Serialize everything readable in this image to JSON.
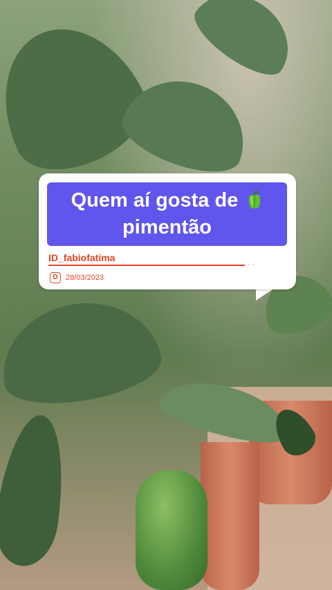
{
  "caption": {
    "line1": "Quem aí gosta de",
    "line2": "pimentão",
    "emoji": "green-bell-pepper"
  },
  "id_label": "ID_fabiofatima",
  "date": "28/03/2023",
  "date_icon_letter": "D",
  "colors": {
    "caption_bg": "#6055ec",
    "caption_text": "#ffffff",
    "accent": "#e2441f",
    "card_bg": "#ffffff"
  }
}
